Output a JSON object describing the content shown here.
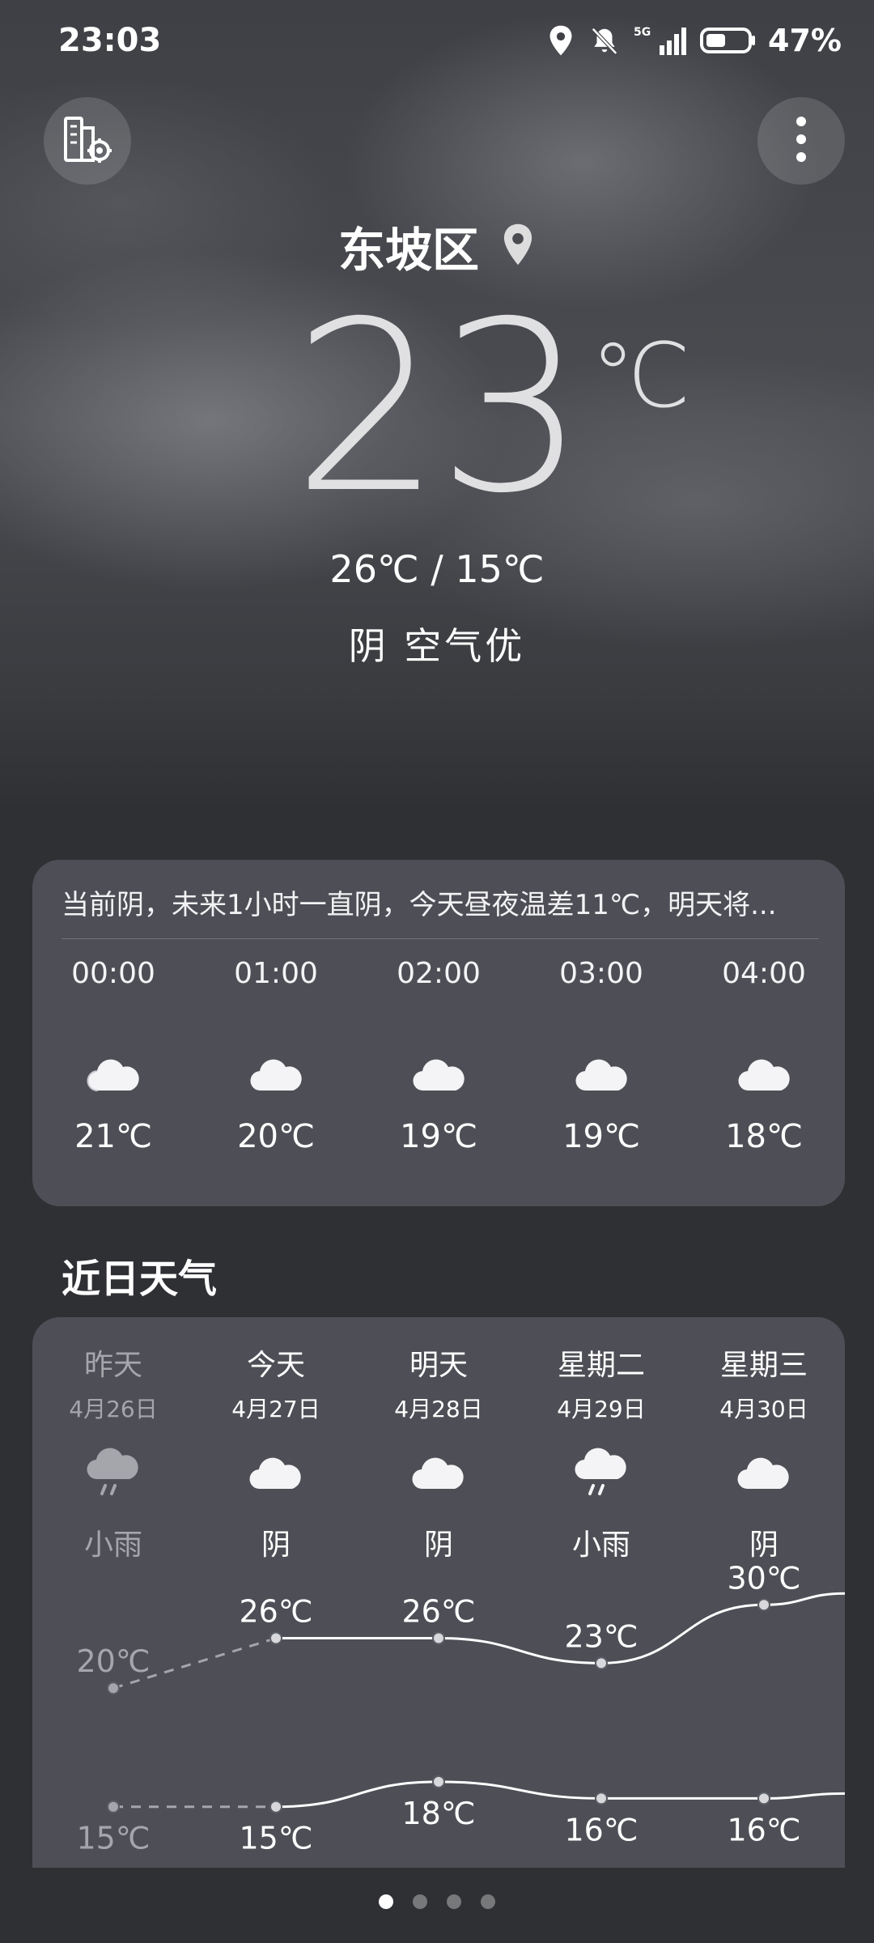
{
  "status_bar": {
    "time": "23:03",
    "network": "5G",
    "battery_percent": "47%",
    "battery_level": 0.47
  },
  "location": {
    "city": "东坡区"
  },
  "current": {
    "temperature": "23",
    "unit": "℃",
    "high_low": "26℃ / 15℃",
    "condition": "阴  空气优"
  },
  "hourly": {
    "summary": "当前阴，未来1小时一直阴，今天昼夜温差11℃，明天将...",
    "items": [
      {
        "time": "00:00",
        "icon": "cloudy-icon",
        "temp": "21℃"
      },
      {
        "time": "01:00",
        "icon": "cloudy-icon",
        "temp": "20℃"
      },
      {
        "time": "02:00",
        "icon": "cloudy-icon",
        "temp": "19℃"
      },
      {
        "time": "03:00",
        "icon": "cloudy-icon",
        "temp": "19℃"
      },
      {
        "time": "04:00",
        "icon": "cloudy-icon",
        "temp": "18℃"
      }
    ]
  },
  "recent": {
    "title": "近日天气",
    "days": [
      {
        "name": "昨天",
        "date": "4月26日",
        "icon": "light-rain-icon",
        "condition": "小雨",
        "high": 20,
        "low": 15,
        "high_label": "20℃",
        "low_label": "15℃",
        "past": true
      },
      {
        "name": "今天",
        "date": "4月27日",
        "icon": "cloudy-icon",
        "condition": "阴",
        "high": 26,
        "low": 15,
        "high_label": "26℃",
        "low_label": "15℃",
        "past": false
      },
      {
        "name": "明天",
        "date": "4月28日",
        "icon": "cloudy-icon",
        "condition": "阴",
        "high": 26,
        "low": 18,
        "high_label": "26℃",
        "low_label": "18℃",
        "past": false
      },
      {
        "name": "星期二",
        "date": "4月29日",
        "icon": "light-rain-icon",
        "condition": "小雨",
        "high": 23,
        "low": 16,
        "high_label": "23℃",
        "low_label": "16℃",
        "past": false
      },
      {
        "name": "星期三",
        "date": "4月30日",
        "icon": "cloudy-icon",
        "condition": "阴",
        "high": 30,
        "low": 16,
        "high_label": "30℃",
        "low_label": "16℃",
        "past": false
      }
    ]
  },
  "pager": {
    "count": 4,
    "active": 0
  },
  "colors": {
    "muted": "#a5a6ab",
    "line": "#ffffff"
  }
}
